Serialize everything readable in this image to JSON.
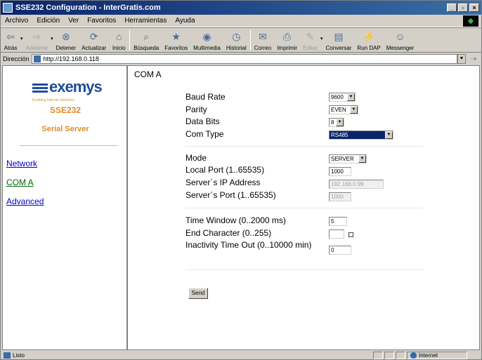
{
  "window": {
    "title": "SSE232 Configuration - InterGratis.com"
  },
  "menu": [
    "Archivo",
    "Edición",
    "Ver",
    "Favoritos",
    "Herramientas",
    "Ayuda"
  ],
  "toolbar": {
    "back": "Atrás",
    "forward": "Adelante",
    "stop": "Detener",
    "refresh": "Actualizar",
    "home": "Inicio",
    "search": "Búsqueda",
    "favorites": "Favoritos",
    "multimedia": "Multimedia",
    "history": "Historial",
    "mail": "Correo",
    "print": "Imprimir",
    "edit": "Editar",
    "discuss": "Conversar",
    "run": "Run DAP",
    "messenger": "Messenger"
  },
  "address": {
    "label": "Dirección",
    "url": "http://192.168.0.118"
  },
  "sidebar": {
    "logo_word": "exemys",
    "logo_tagline": "Enabling Internet Solutions",
    "product": "SSE232",
    "product_sub": "Serial Server",
    "links": [
      "Network",
      "COM A",
      "Advanced"
    ],
    "link_colors": [
      "#0000cc",
      "#006600",
      "#0000cc"
    ]
  },
  "page": {
    "heading": "COM A",
    "baud_label": "Baud Rate",
    "baud_value": "9600",
    "parity_label": "Parity",
    "parity_value": "EVEN",
    "databits_label": "Data Bits",
    "databits_value": "8",
    "comtype_label": "Com Type",
    "comtype_value": "RS485",
    "mode_label": "Mode",
    "mode_value": "SERVER",
    "localport_label": "Local Port (1..65535)",
    "localport_value": "1000",
    "serverip_label": "Server´s IP Address",
    "serverip_value": "192.168.0.99",
    "serverport_label": "Server´s Port (1..65535)",
    "serverport_value": "1000",
    "timewindow_label": "Time Window (0..2000 ms)",
    "timewindow_value": "5",
    "endchar_label": "End Character (0..255)",
    "endchar_value": "",
    "inactivity_label": "Inactivity Time Out (0..10000 min)",
    "inactivity_value": "0",
    "send_label": "Send"
  },
  "status": {
    "left": "Listo",
    "zone": "Internet"
  }
}
